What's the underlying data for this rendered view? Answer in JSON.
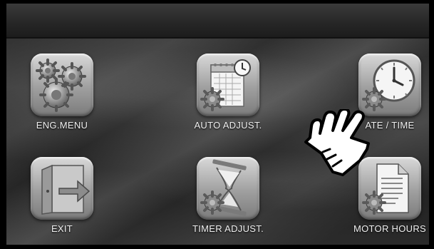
{
  "menu": {
    "items": [
      {
        "id": "eng_menu",
        "label": "ENG.MENU",
        "icon": "gears-icon"
      },
      {
        "id": "auto_adjust",
        "label": "AUTO ADJUST.",
        "icon": "calendar-clock-gear-icon"
      },
      {
        "id": "date_time",
        "label": "ATE / TIME",
        "icon": "clock-gear-icon"
      },
      {
        "id": "exit",
        "label": "EXIT",
        "icon": "exit-door-icon"
      },
      {
        "id": "timer_adjust",
        "label": "TIMER ADJUST.",
        "icon": "hourglass-gear-icon"
      },
      {
        "id": "motor_hours",
        "label": "MOTOR HOURS",
        "icon": "document-gear-icon"
      }
    ]
  },
  "pointer": {
    "icon": "pointing-hand-icon"
  },
  "colors": {
    "tile": "#a9a9a9",
    "background": "#2e2e2e",
    "label": "#f0f0f0"
  }
}
